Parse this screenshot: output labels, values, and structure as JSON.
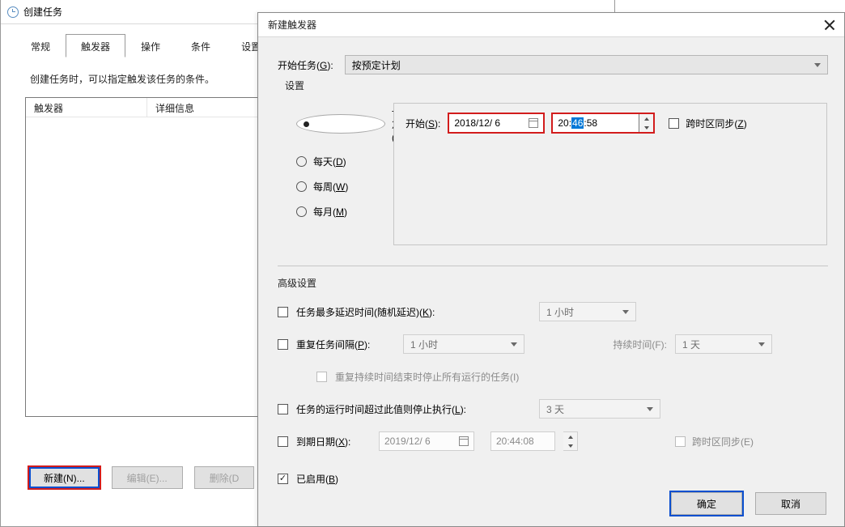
{
  "back_window": {
    "title": "创建任务",
    "tabs": {
      "general": "常规",
      "triggers": "触发器",
      "actions": "操作",
      "conditions": "条件",
      "settings": "设置"
    },
    "desc": "创建任务时，可以指定触发该任务的条件。",
    "columns": {
      "trigger": "触发器",
      "details": "详细信息"
    },
    "buttons": {
      "new": "新建(N)...",
      "edit": "编辑(E)...",
      "delete": "删除(D"
    }
  },
  "dialog": {
    "title": "新建触发器",
    "start_task_label": "开始任务(G):",
    "start_task_value": "按预定计划",
    "settings_legend": "设置",
    "freq": {
      "once": "一次(N)",
      "daily": "每天(D)",
      "weekly": "每周(W)",
      "monthly": "每月(M)"
    },
    "start_label": "开始(S):",
    "start_date": "2018/12/ 6",
    "start_time_pre": "20:",
    "start_time_sel": "46",
    "start_time_post": ":58",
    "sync_tz": "跨时区同步(Z)",
    "advanced_legend": "高级设置",
    "adv": {
      "random_delay": "任务最多延迟时间(随机延迟)(K):",
      "random_delay_val": "1 小时",
      "repeat": "重复任务间隔(P):",
      "repeat_val": "1 小时",
      "duration_label": "持续时间(F):",
      "duration_val": "1 天",
      "stop_after_repeat": "重复持续时间结束时停止所有运行的任务(I)",
      "stop_if_longer": "任务的运行时间超过此值则停止执行(L):",
      "stop_if_longer_val": "3 天",
      "expire": "到期日期(X):",
      "expire_date": "2019/12/ 6",
      "expire_time": "20:44:08",
      "expire_sync": "跨时区同步(E)",
      "enabled": "已启用(B)"
    },
    "ok": "确定",
    "cancel": "取消"
  }
}
